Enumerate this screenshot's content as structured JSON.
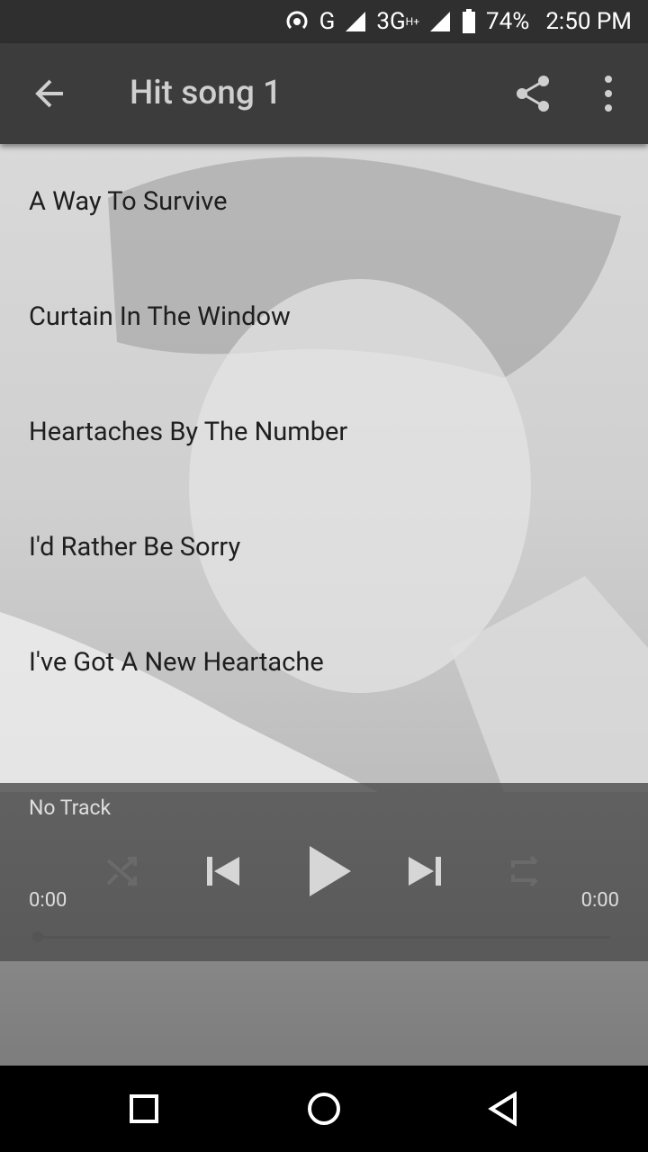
{
  "status_bar": {
    "network": "G",
    "network2": "3G",
    "network2_sup": "H+",
    "battery": "74%",
    "time": "2:50 PM"
  },
  "app_bar": {
    "title": "Hit song 1"
  },
  "songs": [
    "A Way To Survive",
    "Curtain In The Window",
    "Heartaches By The Number",
    "I'd Rather Be Sorry",
    "I've Got A New Heartache"
  ],
  "player": {
    "track": "No Track",
    "time_elapsed": "0:00",
    "time_total": "0:00",
    "progress": 0
  },
  "colors": {
    "status_bar_bg": "#2f2f2f",
    "app_bar_bg": "#3c3c3c",
    "player_bg": "#464646"
  }
}
